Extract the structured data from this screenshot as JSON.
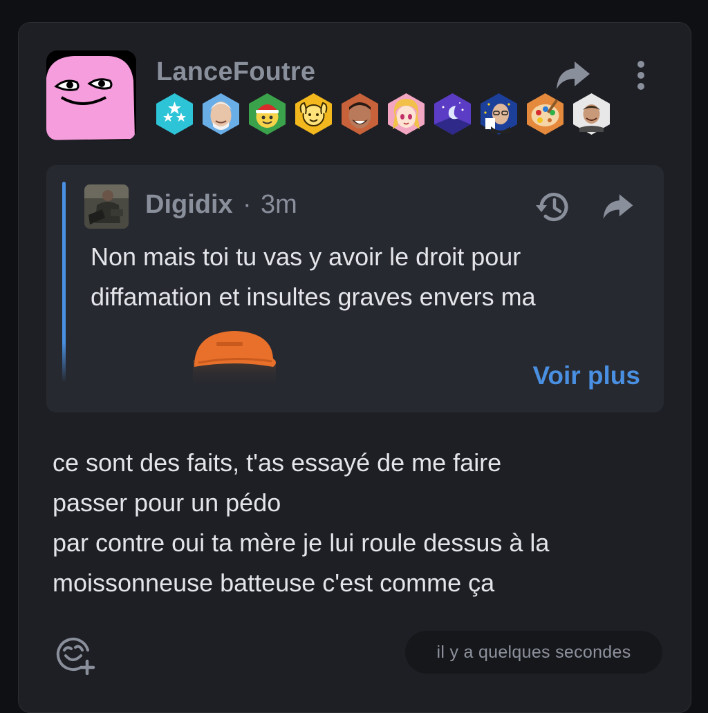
{
  "post": {
    "username": "LanceFoutre",
    "badges": [
      {
        "icon": "three-stars-badge-icon",
        "color": "#2ec4d8"
      },
      {
        "icon": "smiling-old-man-badge-icon",
        "color": "#6aaee8"
      },
      {
        "icon": "christmas-hat-smiley-badge-icon",
        "color": "#3aa24a"
      },
      {
        "icon": "hands-up-smiley-badge-icon",
        "color": "#f2b81e"
      },
      {
        "icon": "laughing-man-badge-icon",
        "color": "#c8623a"
      },
      {
        "icon": "anime-girl-badge-icon",
        "color": "#f3a6c2"
      },
      {
        "icon": "moon-night-badge-icon",
        "color": "#5b3cc4"
      },
      {
        "icon": "eu-politician-badge-icon",
        "color": "#1c3f9a"
      },
      {
        "icon": "paint-palette-badge-icon",
        "color": "#e58a3c"
      },
      {
        "icon": "meme-face-badge-icon",
        "color": "#e8e8e8"
      }
    ],
    "message": "ce sont des faits, t'as essayé de me faire\npasser pour un pédo\npar contre oui ta mère je lui roule dessus à la\nmoissonneuse batteuse c'est comme ça",
    "timestamp": "il y a quelques secondes"
  },
  "quote": {
    "author": "Digidix",
    "separator": "·",
    "time": "3m",
    "text": "Non mais toi tu vas y avoir le droit pour diffamation et insultes graves envers ma",
    "more_label": "Voir plus",
    "accent": "#4a90e2"
  },
  "colors": {
    "card": "#1e1f24",
    "quote_bg": "#272930",
    "link": "#4a90e2",
    "muted": "#8a8f9c",
    "text": "#e3e5ea"
  }
}
